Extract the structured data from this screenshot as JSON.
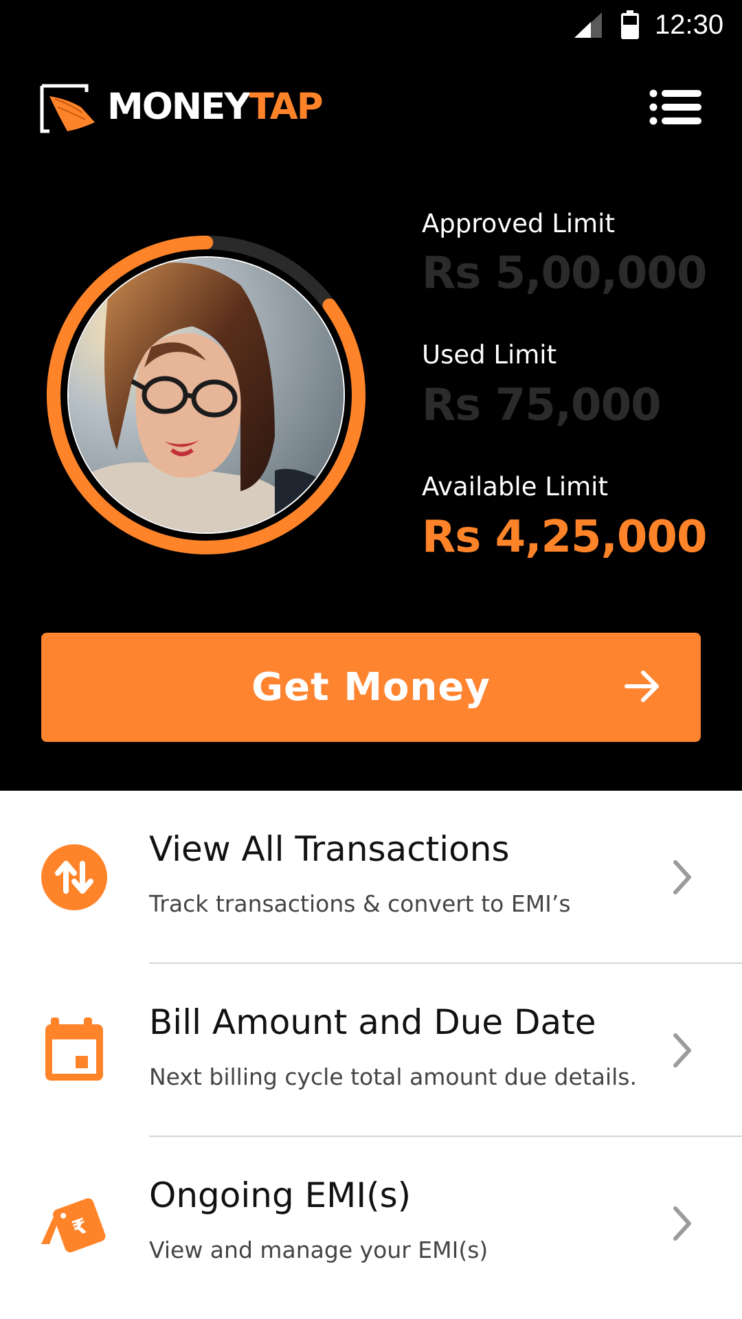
{
  "status_bar": {
    "time": "12:30"
  },
  "header": {
    "logo_part1": "MONEY",
    "logo_part2": "TAP"
  },
  "colors": {
    "accent": "#ff8429",
    "background_dark": "#000000",
    "dim_text": "#2b2b2b"
  },
  "credit_usage_fraction": 0.15,
  "limits": [
    {
      "label": "Approved Limit",
      "value": "Rs 5,00,000"
    },
    {
      "label": "Used Limit",
      "value": "Rs 75,000"
    },
    {
      "label": "Available Limit",
      "value": "Rs 4,25,000"
    }
  ],
  "cta": {
    "label": "Get Money"
  },
  "menu_items": [
    {
      "title": "View All Transactions",
      "subtitle": "Track transactions & convert to EMI’s",
      "icon": "transactions-icon"
    },
    {
      "title": "Bill Amount and Due Date",
      "subtitle": "Next billing cycle total amount due details.",
      "icon": "calendar-icon"
    },
    {
      "title": "Ongoing EMI(s)",
      "subtitle": "View and manage your EMI(s)",
      "icon": "emi-tag-icon"
    }
  ]
}
